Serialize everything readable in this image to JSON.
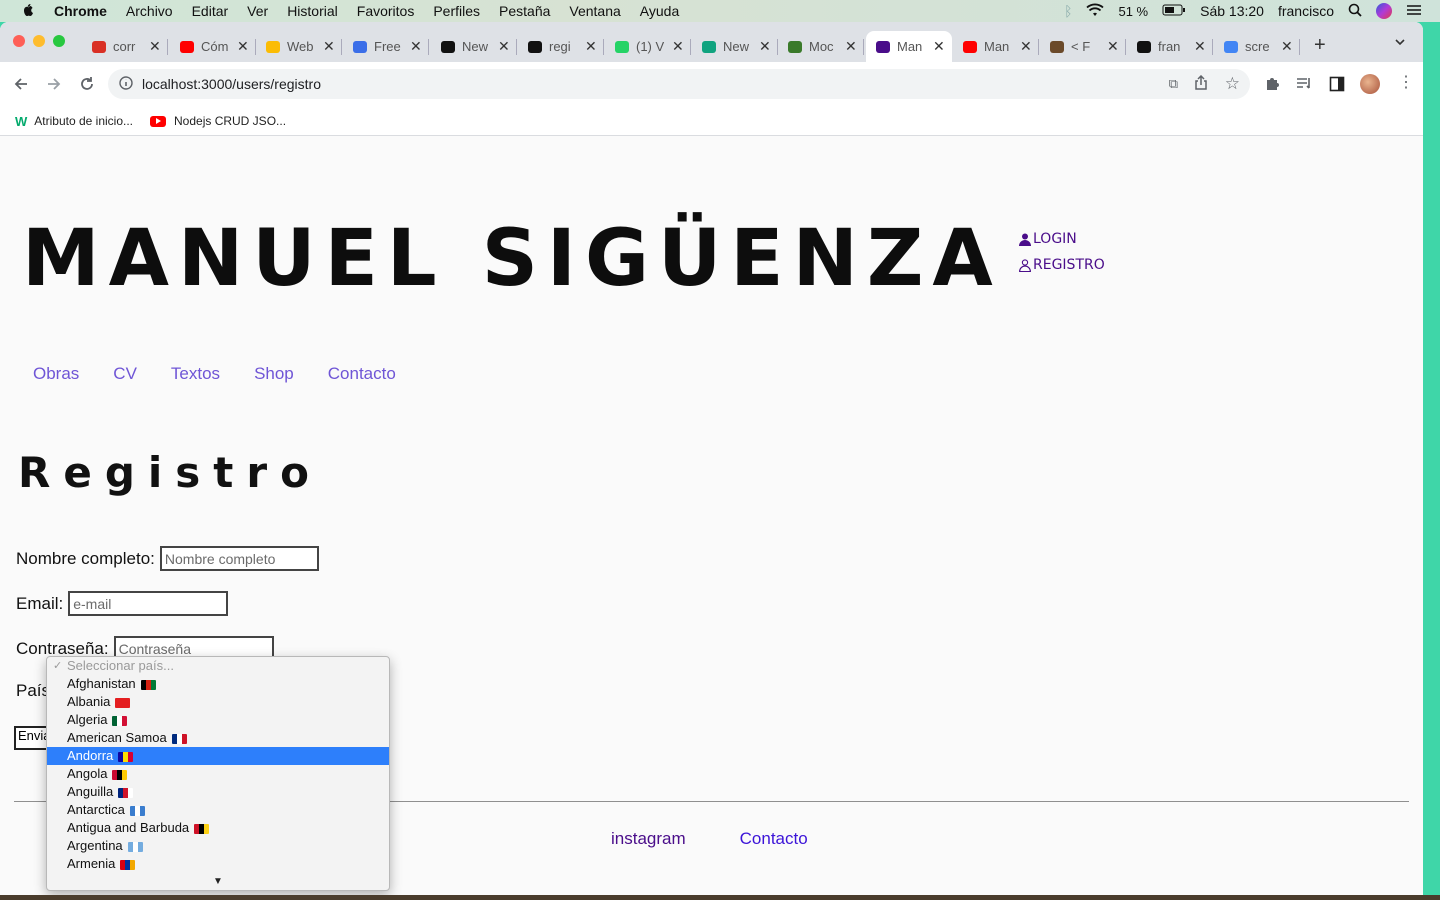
{
  "menubar": {
    "app": "Chrome",
    "items": [
      "Archivo",
      "Editar",
      "Ver",
      "Historial",
      "Favoritos",
      "Perfiles",
      "Pestaña",
      "Ventana",
      "Ayuda"
    ],
    "battery": "51 %",
    "clock": "Sáb 13:20",
    "user": "francisco"
  },
  "tabs": [
    {
      "title": "corr",
      "icon": "gmail-icon",
      "color": "#d93025"
    },
    {
      "title": "Cóm",
      "icon": "youtube-icon",
      "color": "#ff0000"
    },
    {
      "title": "Web",
      "icon": "google-drive-icon",
      "color": "#fbbc04"
    },
    {
      "title": "Free",
      "icon": "flag-icon",
      "color": "#3b6ee8"
    },
    {
      "title": "New",
      "icon": "github-icon",
      "color": "#111111"
    },
    {
      "title": "regi",
      "icon": "github-icon",
      "color": "#111111"
    },
    {
      "title": "(1) V",
      "icon": "whatsapp-icon",
      "color": "#25d366"
    },
    {
      "title": "New",
      "icon": "openai-icon",
      "color": "#10a37f"
    },
    {
      "title": "Moc",
      "icon": "plane-icon",
      "color": "#3a7a2a"
    },
    {
      "title": "Man",
      "icon": "page-icon",
      "color": "#4a0d8a",
      "active": true
    },
    {
      "title": "Man",
      "icon": "youtube-icon",
      "color": "#ff0000"
    },
    {
      "title": "< F",
      "icon": "avatar-icon",
      "color": "#6b4a2a"
    },
    {
      "title": "fran",
      "icon": "github-icon",
      "color": "#111111"
    },
    {
      "title": "scre",
      "icon": "google-icon",
      "color": "#4285f4"
    }
  ],
  "address": {
    "url": "localhost:3000/users/registro"
  },
  "bookmarks": [
    {
      "label": "Atributo de inicio...",
      "icon": "w3schools-icon"
    },
    {
      "label": "Nodejs CRUD JSO...",
      "icon": "youtube-icon"
    }
  ],
  "site": {
    "title": "MANUEL SIGÜENZA",
    "login": "LOGIN",
    "registro": "REGISTRO",
    "nav": [
      "Obras",
      "CV",
      "Textos",
      "Shop",
      "Contacto"
    ]
  },
  "form": {
    "heading": "Registro",
    "name_label": "Nombre completo:",
    "name_placeholder": "Nombre completo",
    "email_label": "Email:",
    "email_placeholder": "e-mail",
    "password_label": "Contraseña:",
    "password_placeholder": "Contraseña",
    "country_label": "País",
    "submit_label": "Enviar"
  },
  "dropdown": {
    "placeholder": "Seleccionar país...",
    "options": [
      {
        "label": "Afghanistan",
        "colors": [
          "#000000",
          "#d32011",
          "#007a36"
        ]
      },
      {
        "label": "Albania",
        "colors": [
          "#e41e20",
          "#e41e20",
          "#e41e20"
        ]
      },
      {
        "label": "Algeria",
        "colors": [
          "#006233",
          "#ffffff",
          "#d21034"
        ]
      },
      {
        "label": "American Samoa",
        "colors": [
          "#002b7f",
          "#ffffff",
          "#ce1126"
        ]
      },
      {
        "label": "Andorra",
        "colors": [
          "#10069f",
          "#fedd00",
          "#d50032"
        ],
        "selected": true
      },
      {
        "label": "Angola",
        "colors": [
          "#cc092f",
          "#000000",
          "#ffcb00"
        ]
      },
      {
        "label": "Anguilla",
        "colors": [
          "#00247d",
          "#cf142b",
          "#ffffff"
        ]
      },
      {
        "label": "Antarctica",
        "colors": [
          "#3a7dce",
          "#ffffff",
          "#3a7dce"
        ]
      },
      {
        "label": "Antigua and Barbuda",
        "colors": [
          "#ce1126",
          "#000000",
          "#fcd116"
        ]
      },
      {
        "label": "Argentina",
        "colors": [
          "#74acdf",
          "#ffffff",
          "#74acdf"
        ]
      },
      {
        "label": "Armenia",
        "colors": [
          "#d90012",
          "#0033a0",
          "#f2a800"
        ]
      }
    ]
  },
  "footer": {
    "links": [
      "instagram",
      "Contacto"
    ]
  },
  "colors": {
    "accent": "#6f55d6",
    "dark_purple": "#4a0d8a",
    "selection": "#2d7ffb",
    "desktop": "#3fd6a8"
  }
}
